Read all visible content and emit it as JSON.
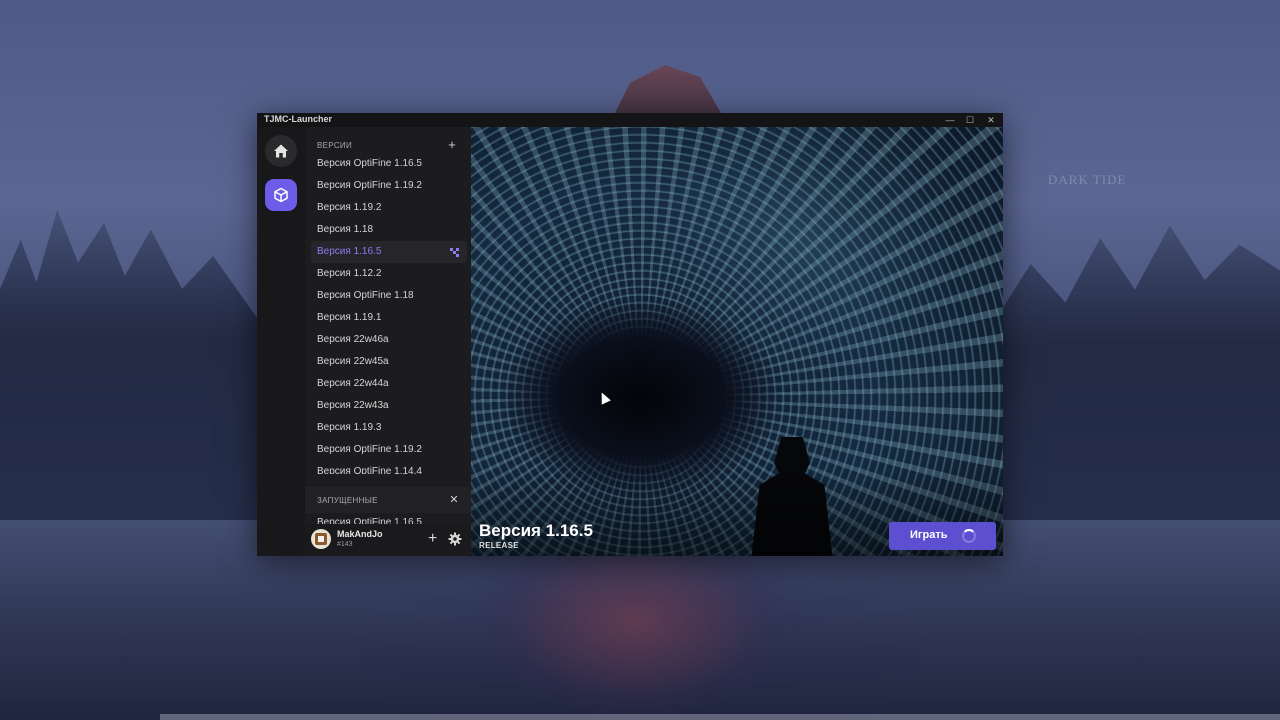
{
  "window": {
    "title": "TJMC-Launcher",
    "minimize": "—",
    "maximize": "☐",
    "close": "✕"
  },
  "background": {
    "watermark": "DARK TIDE"
  },
  "rail": {
    "home_icon": "home-icon",
    "versions_icon": "cube-icon"
  },
  "versions_panel": {
    "header": "ВЕРСИИ",
    "add": "+",
    "items": [
      {
        "label": "Версия OptiFine 1.16.5"
      },
      {
        "label": "Версия OptiFine 1.19.2"
      },
      {
        "label": "Версия 1.19.2"
      },
      {
        "label": "Версия 1.18"
      },
      {
        "label": "Версия 1.16.5",
        "active": true
      },
      {
        "label": "Версия 1.12.2"
      },
      {
        "label": "Версия OptiFine 1.18"
      },
      {
        "label": "Версия 1.19.1"
      },
      {
        "label": "Версия 22w46a"
      },
      {
        "label": "Версия 22w45a"
      },
      {
        "label": "Версия 22w44a"
      },
      {
        "label": "Версия 22w43a"
      },
      {
        "label": "Версия 1.19.3"
      },
      {
        "label": "Версия OptiFine 1.19.2"
      },
      {
        "label": "Версия OptiFine 1.14.4"
      }
    ]
  },
  "running_panel": {
    "header": "ЗАПУЩЕННЫЕ",
    "close": "✕",
    "items": [
      {
        "label": "Версия OptiFine 1.16.5"
      }
    ]
  },
  "user": {
    "name": "MakAndJo",
    "tag": "#143",
    "add": "+"
  },
  "hero": {
    "title": "Версия 1.16.5",
    "subtitle": "RELEASE",
    "play_label": "Играть"
  },
  "colors": {
    "accent": "#6c5ce7",
    "play_button": "#5c4fd0",
    "active_text": "#8b7cf0"
  }
}
